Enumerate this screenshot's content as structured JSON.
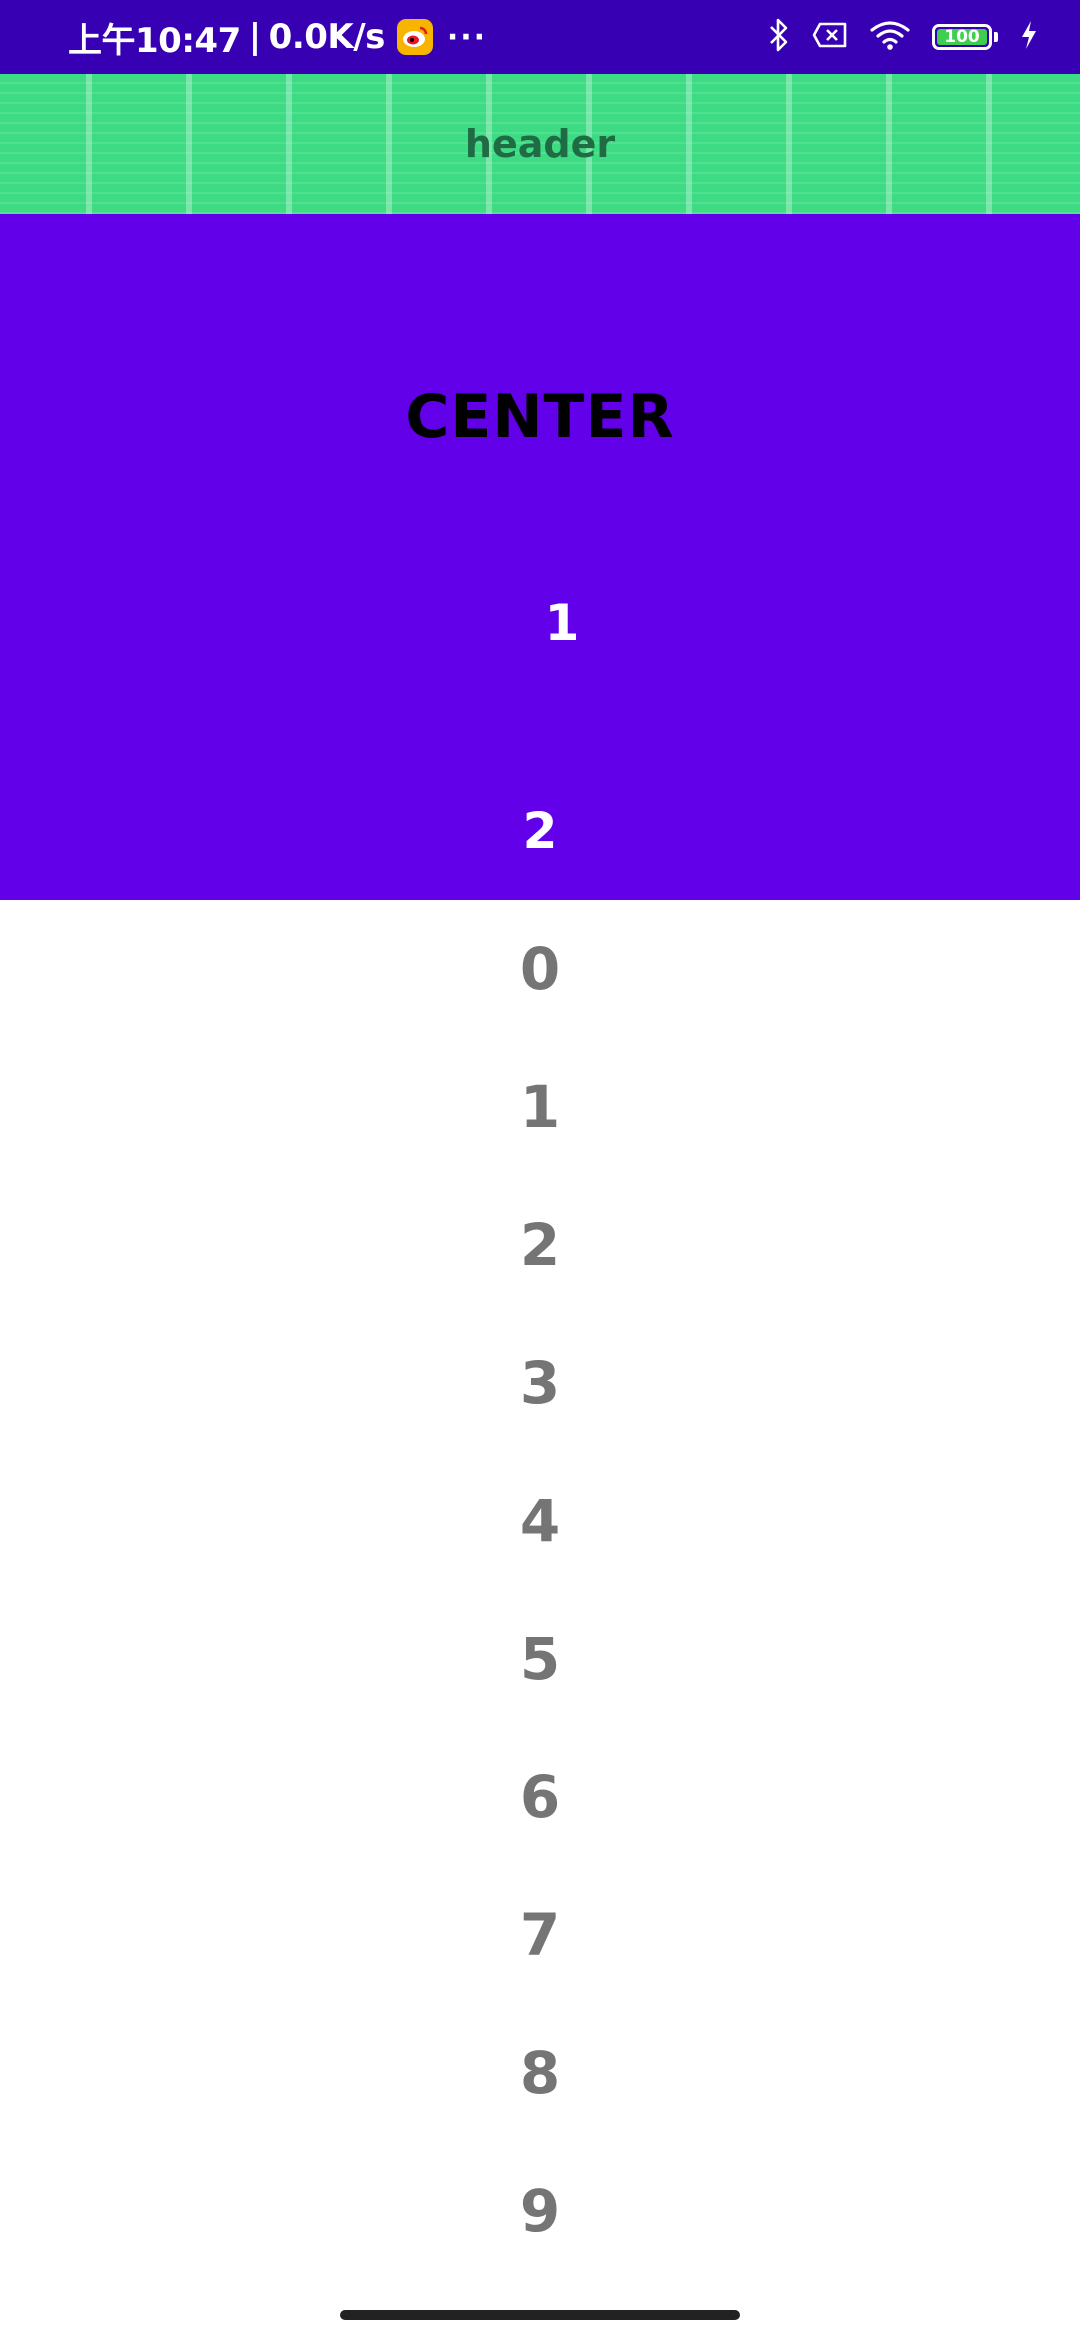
{
  "status_bar": {
    "time": "上午10:47",
    "network_speed": "0.0K/s",
    "more": "···",
    "battery": "100"
  },
  "header": {
    "title": "header"
  },
  "center_panel": {
    "title": "CENTER",
    "item_a": "1",
    "item_b": "2"
  },
  "list": {
    "items": [
      "0",
      "1",
      "2",
      "3",
      "4",
      "5",
      "6",
      "7",
      "8",
      "9"
    ]
  },
  "colors": {
    "status_bar": "#3700b3",
    "header": "#3ddc84",
    "center_panel": "#6200ea",
    "list_text": "#757575"
  }
}
